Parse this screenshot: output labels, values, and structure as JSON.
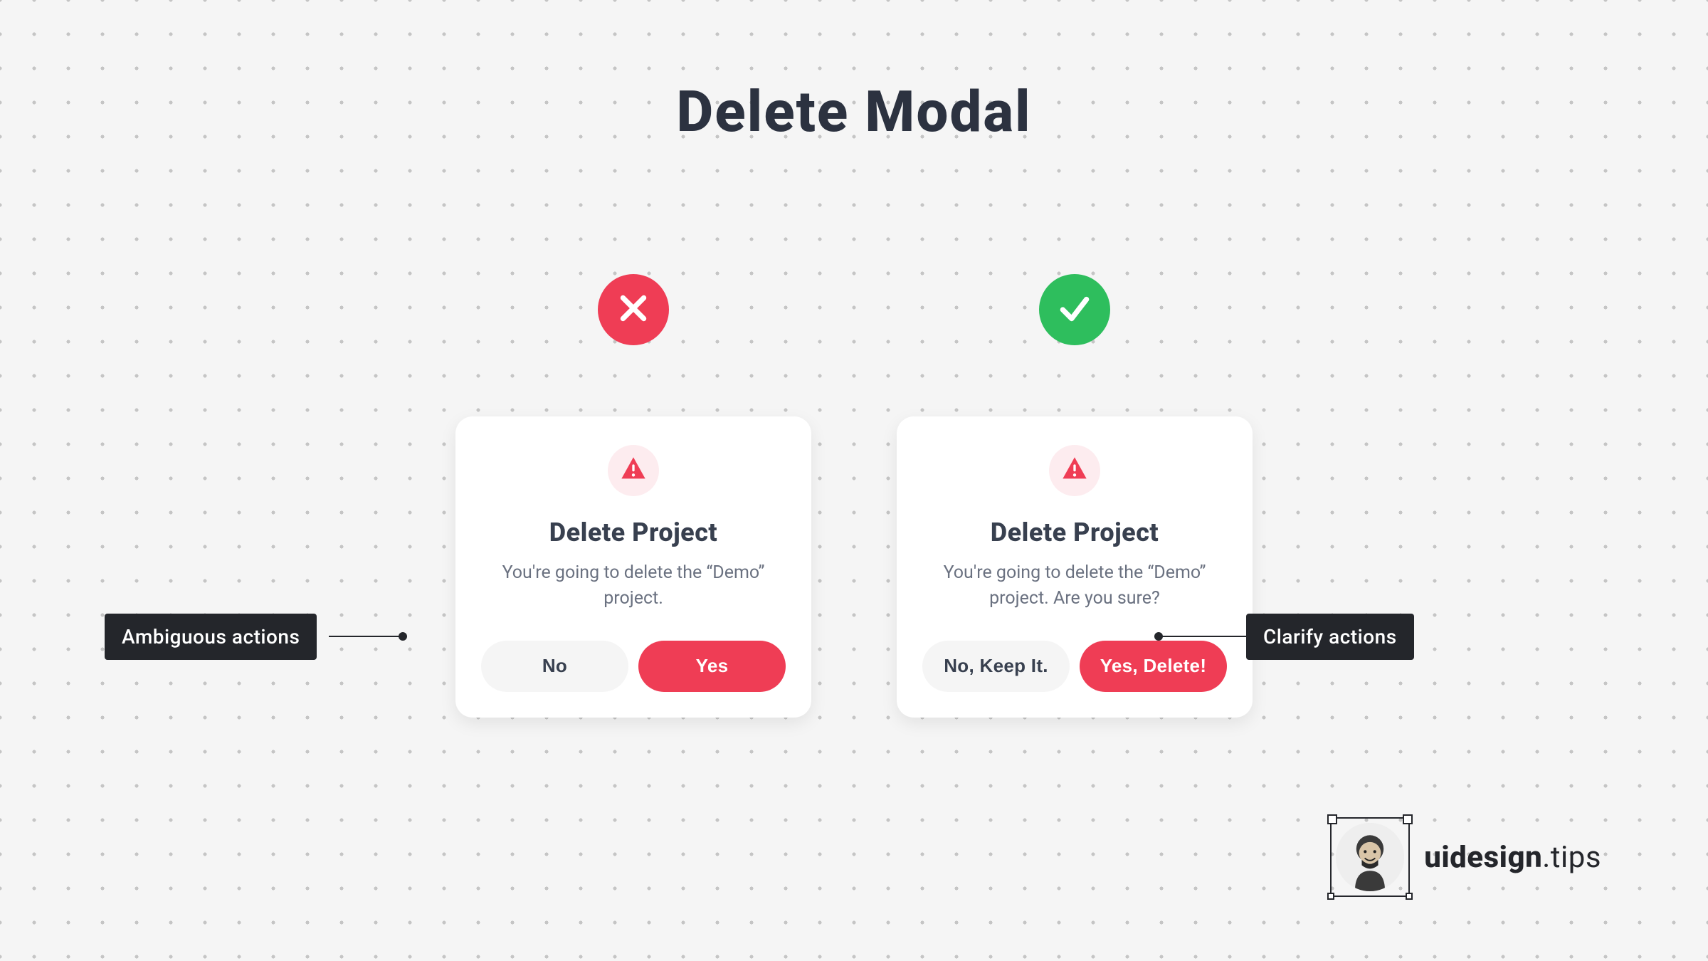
{
  "title": "Delete Modal",
  "bad_example": {
    "indicator": "bad",
    "modal_title": "Delete Project",
    "modal_body": "You're going to delete the “Demo” project.",
    "btn_secondary": "No",
    "btn_primary": "Yes",
    "callout": "Ambiguous actions"
  },
  "good_example": {
    "indicator": "good",
    "modal_title": "Delete Project",
    "modal_body": "You're going to delete the “Demo” project. Are you sure?",
    "btn_secondary": "No, Keep It.",
    "btn_primary": "Yes, Delete!",
    "callout": "Clarify actions"
  },
  "branding": {
    "bold": "uidesign",
    "light": ".tips"
  },
  "colors": {
    "danger": "#ef3d55",
    "success": "#2ebe5d",
    "text_heading": "#2c3240",
    "text_body": "#6a7180",
    "callout_bg": "#24262b"
  }
}
